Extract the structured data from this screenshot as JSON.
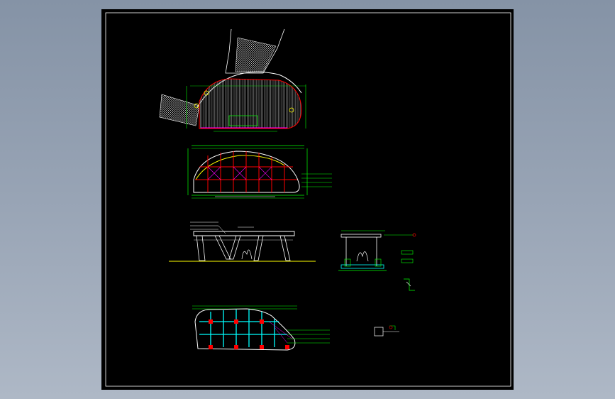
{
  "colors": {
    "background": "#000000",
    "frame": "#ffffff",
    "outline": "#ffffff",
    "dimension": "#00ff00",
    "column": "#ff0000",
    "paving": "#c0c0c0",
    "grid_cyan": "#00ffff",
    "roof_yellow": "#ffff00",
    "magenta": "#ff00ff",
    "ground": "#ffff00"
  },
  "icons": {
    "zoom": "magnifier-icon",
    "detail_marker": "circle-marker-icon"
  }
}
